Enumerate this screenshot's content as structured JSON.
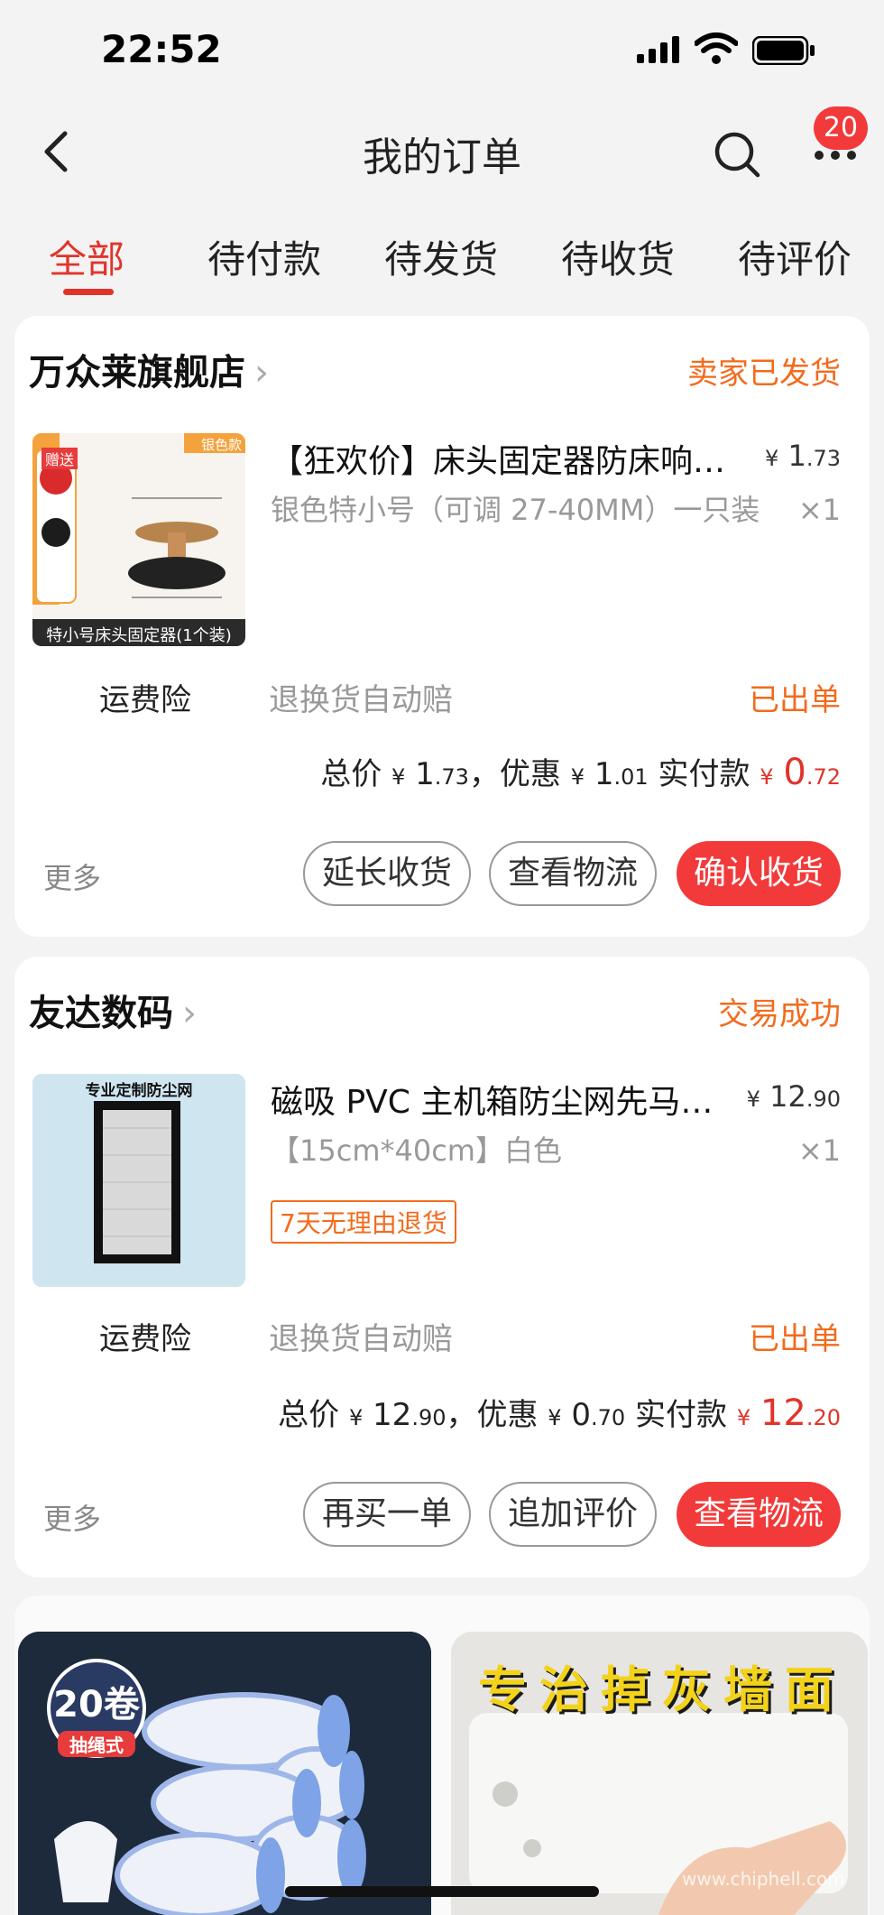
{
  "status_bar": {
    "time": "22:52"
  },
  "nav": {
    "title": "我的订单",
    "badge": "20"
  },
  "tabs": [
    {
      "label": "全部"
    },
    {
      "label": "待付款"
    },
    {
      "label": "待发货"
    },
    {
      "label": "待收货"
    },
    {
      "label": "待评价"
    }
  ],
  "orders": [
    {
      "shop": "万众莱旗舰店",
      "status": "卖家已发货",
      "thumb": {
        "badge": "银色款",
        "gift": "赠送",
        "caption": "特小号床头固定器(1个装)"
      },
      "title": "【狂欢价】床头固定器防床响…",
      "price_currency": "¥",
      "price_int": "1",
      "price_dec": ".73",
      "spec": "银色特小号（可调 27-40MM）一只装",
      "qty": "×1",
      "insurance_label": "运费险",
      "insurance_desc": "退换货自动赔",
      "insurance_status": "已出单",
      "total_label": "总价",
      "total_int": "1",
      "total_dec": ".73",
      "discount_label": "，优惠",
      "discount_int": "1",
      "discount_dec": ".01",
      "paid_label": "实付款",
      "paid_int": "0",
      "paid_dec": ".72",
      "more": "更多",
      "buttons": [
        "延长收货",
        "查看物流",
        "确认收货"
      ]
    },
    {
      "shop": "友达数码",
      "status": "交易成功",
      "thumb": {
        "caption": "专业定制防尘网"
      },
      "title": "磁吸 PVC 主机箱防尘网先马…",
      "price_currency": "¥",
      "price_int": "12",
      "price_dec": ".90",
      "spec": "【15cm*40cm】白色",
      "qty": "×1",
      "tag": "7天无理由退货",
      "insurance_label": "运费险",
      "insurance_desc": "退换货自动赔",
      "insurance_status": "已出单",
      "total_label": "总价",
      "total_int": "12",
      "total_dec": ".90",
      "discount_label": "，优惠",
      "discount_int": "0",
      "discount_dec": ".70",
      "paid_label": "实付款",
      "paid_int": "12",
      "paid_dec": ".20",
      "more": "更多",
      "buttons": [
        "再买一单",
        "追加评价",
        "查看物流"
      ]
    }
  ],
  "ads": {
    "left": {
      "badge_num": "20卷",
      "badge_sub": "抽绳式"
    },
    "right": {
      "title": "专治掉灰墙面"
    }
  },
  "colors": {
    "accent": "#e0342b",
    "status_orange": "#f26b1d",
    "primary_button": "#f23a3a"
  }
}
